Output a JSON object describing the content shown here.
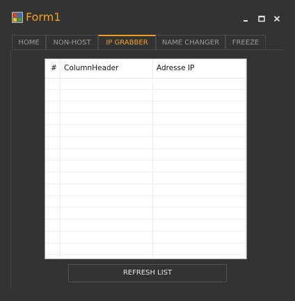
{
  "window": {
    "title": "Form1"
  },
  "tabs": [
    {
      "label": "HOME"
    },
    {
      "label": "NON-HOST"
    },
    {
      "label": "IP GRABBER"
    },
    {
      "label": "NAME CHANGER"
    },
    {
      "label": "FREEZE"
    }
  ],
  "active_tab": "IP GRABBER",
  "list": {
    "columns": [
      "#",
      "ColumnHeader",
      "Adresse IP"
    ]
  },
  "refresh_label": "REFRESH LIST",
  "colors": {
    "accent": "#f5a020",
    "background": "#333333"
  }
}
